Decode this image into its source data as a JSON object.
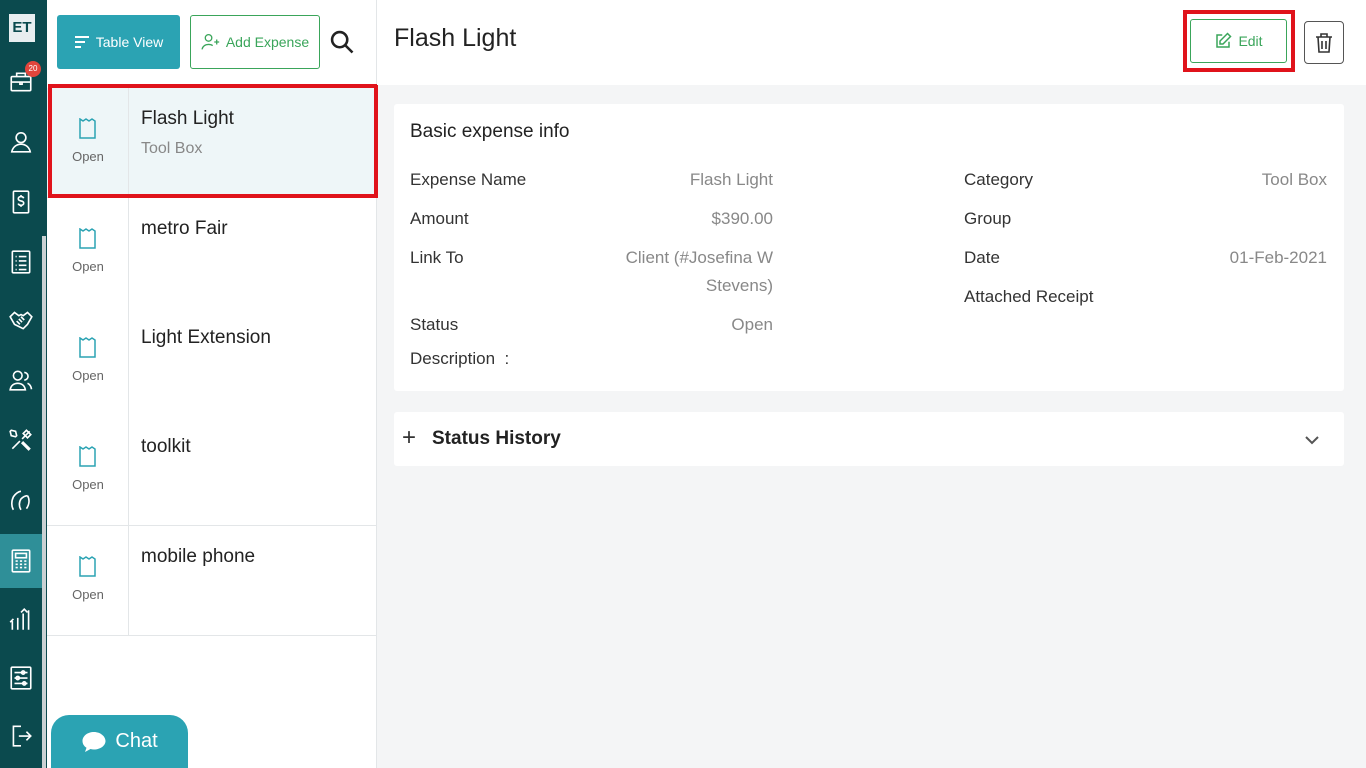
{
  "app": {
    "logo_text": "ET",
    "notification_count": "20"
  },
  "nav": [
    {
      "icon": "briefcase-icon"
    },
    {
      "icon": "user-icon"
    },
    {
      "icon": "dollar-icon"
    },
    {
      "icon": "checklist-icon"
    },
    {
      "icon": "handshake-icon"
    },
    {
      "icon": "users-icon"
    },
    {
      "icon": "tools-icon"
    },
    {
      "icon": "leads-icon"
    },
    {
      "icon": "calculator-icon",
      "active": true
    },
    {
      "icon": "reports-icon"
    },
    {
      "icon": "settings-sliders-icon"
    },
    {
      "icon": "logout-icon"
    }
  ],
  "toolbar": {
    "table_view_label": "Table View",
    "add_expense_label": "Add Expense"
  },
  "expenses": [
    {
      "name": "Flash Light",
      "category": "Tool Box",
      "status": "Open",
      "selected": true
    },
    {
      "name": "metro Fair",
      "category": "",
      "status": "Open"
    },
    {
      "name": "Light Extension",
      "category": "",
      "status": "Open"
    },
    {
      "name": "toolkit",
      "category": "",
      "status": "Open"
    },
    {
      "name": "mobile phone",
      "category": "",
      "status": "Open"
    }
  ],
  "chat": {
    "label": "Chat"
  },
  "detail": {
    "title": "Flash Light",
    "edit_label": "Edit",
    "section_title": "Basic expense info",
    "fields": {
      "expense_name": {
        "label": "Expense Name",
        "value": "Flash Light"
      },
      "amount": {
        "label": "Amount",
        "value": "$390.00"
      },
      "link_to": {
        "label": "Link To",
        "value_line1": "Client (#Josefina W",
        "value_line2": "Stevens)"
      },
      "status": {
        "label": "Status",
        "value": "Open"
      },
      "description": {
        "label": "Description  :"
      },
      "category": {
        "label": "Category",
        "value": "Tool Box"
      },
      "group": {
        "label": "Group",
        "value": ""
      },
      "date": {
        "label": "Date",
        "value": "01-Feb-2021"
      },
      "receipt": {
        "label": "Attached Receipt"
      }
    },
    "status_history_label": "Status History"
  },
  "colors": {
    "rail": "#0b4a4e",
    "accent": "#2ba3b3",
    "green": "#3aa55a",
    "highlight": "#e0131b"
  }
}
